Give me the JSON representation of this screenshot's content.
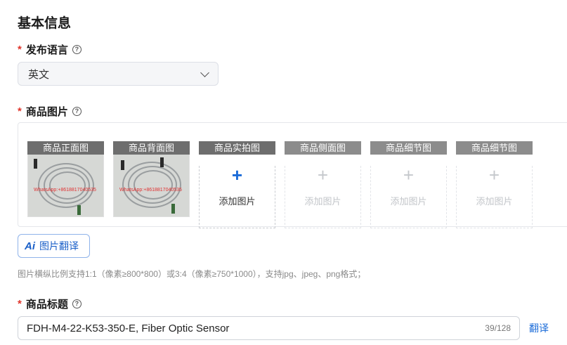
{
  "section": {
    "title": "基本信息"
  },
  "language": {
    "label": "发布语言",
    "required_mark": "*",
    "help_icon": "question-circle-icon",
    "selected": "英文"
  },
  "images": {
    "label": "商品图片",
    "required_mark": "*",
    "help_icon": "question-circle-icon",
    "slots": [
      {
        "caption": "商品正面图",
        "filled": true,
        "watermark": "WhatsApp:+8618817040535"
      },
      {
        "caption": "商品背面图",
        "filled": true,
        "watermark": "WhatsApp:+8618817040535"
      },
      {
        "caption": "商品实拍图",
        "filled": false,
        "active": true,
        "add_label": "添加图片"
      },
      {
        "caption": "商品侧面图",
        "filled": false,
        "active": false,
        "add_label": "添加图片"
      },
      {
        "caption": "商品细节图",
        "filled": false,
        "active": false,
        "add_label": "添加图片"
      },
      {
        "caption": "商品细节图",
        "filled": false,
        "active": false,
        "add_label": "添加图片"
      }
    ],
    "ai_button": {
      "icon_text": "Ai",
      "label": "图片翻译"
    },
    "hint": "图片横纵比例支持1:1（像素≥800*800）或3:4（像素≥750*1000），支持jpg、jpeg、png格式；"
  },
  "product_title": {
    "label": "商品标题",
    "required_mark": "*",
    "help_icon": "question-circle-icon",
    "value": "FDH-M4-22-K53-350-E, Fiber Optic Sensor",
    "counter": "39/128",
    "translate_label": "翻译"
  },
  "colors": {
    "accent": "#1a6bd8",
    "required": "#e0352b"
  }
}
